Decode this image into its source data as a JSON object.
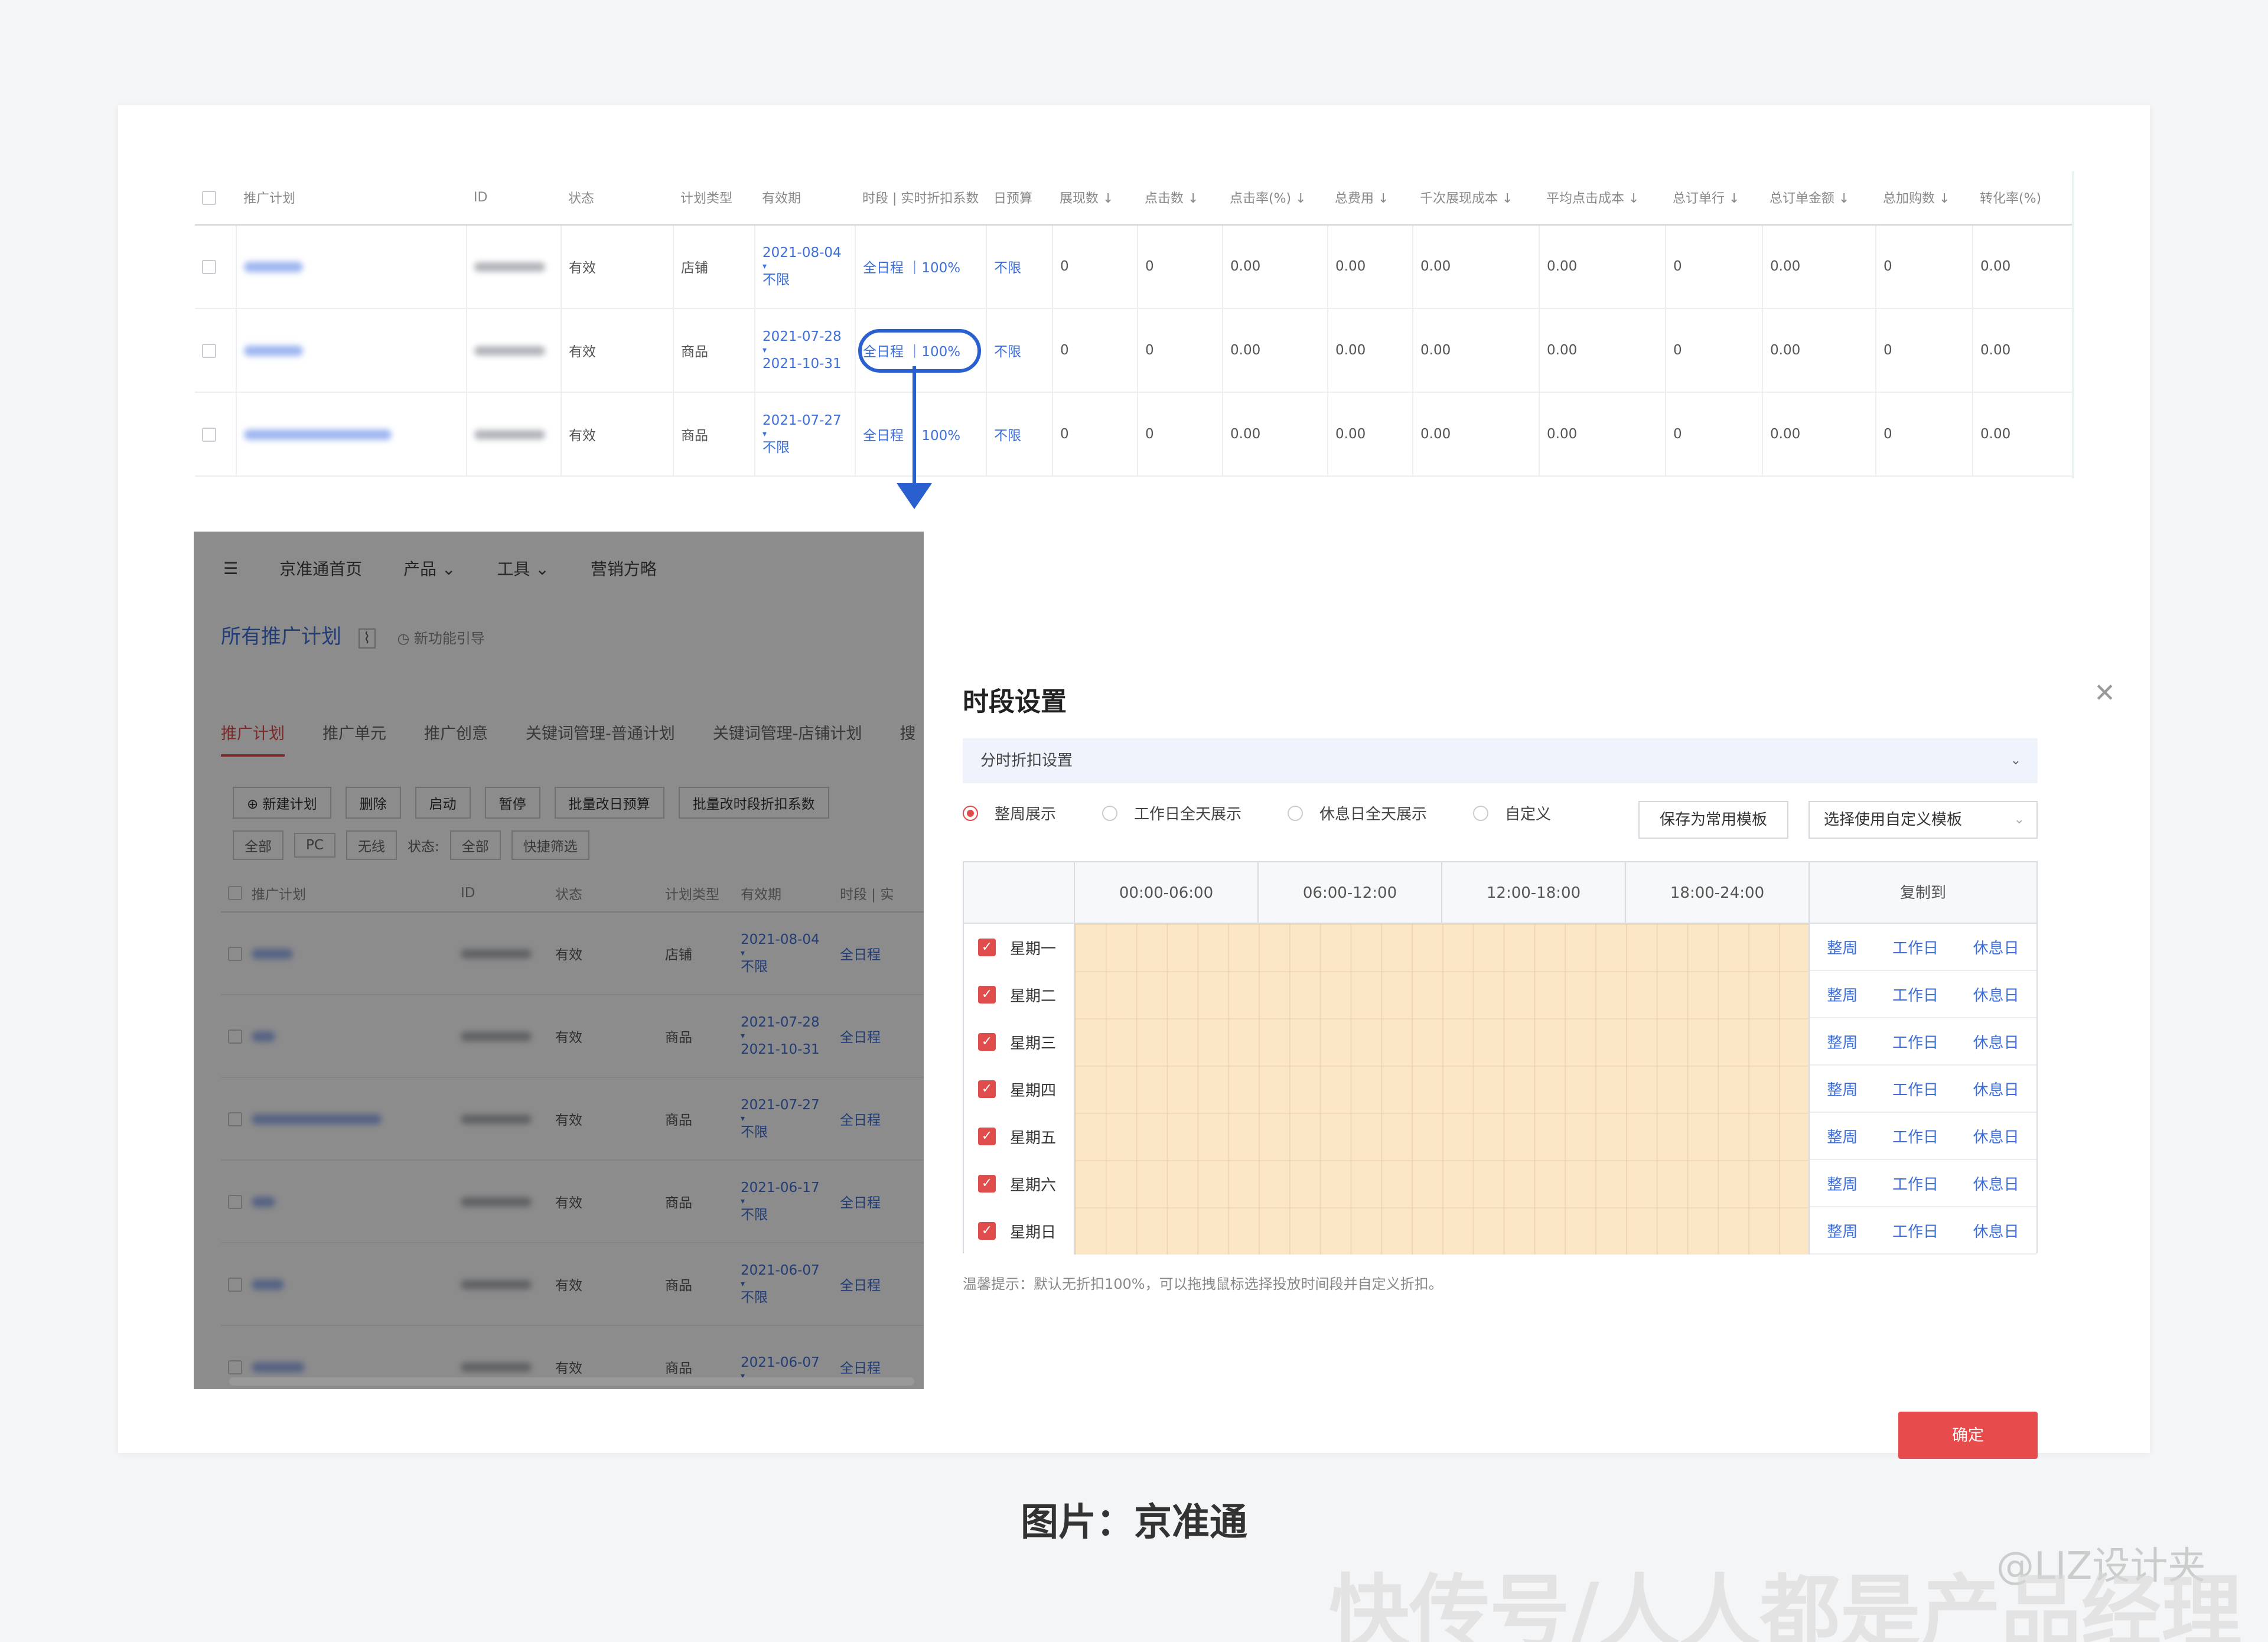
{
  "top_table": {
    "headers": [
      "推广计划",
      "ID",
      "状态",
      "计划类型",
      "有效期",
      "时段 | 实时折扣系数",
      "日预算",
      "展现数 ↓",
      "点击数 ↓",
      "点击率(%) ↓",
      "总费用 ↓",
      "千次展现成本 ↓",
      "平均点击成本 ↓",
      "总订单行 ↓",
      "总订单金额 ↓",
      "总加购数 ↓",
      "转化率(%)"
    ],
    "rows": [
      {
        "status": "有效",
        "type": "店铺",
        "date1": "2021-08-04",
        "date2": "不限",
        "period": "全日程 ｜100%",
        "budget": "不限",
        "impr": "0",
        "clicks": "0",
        "ctr": "0.00",
        "cost": "0.00",
        "cpm": "0.00",
        "cpc": "0.00",
        "orders": "0",
        "amount": "0.00",
        "cart": "0",
        "cvr": "0.00"
      },
      {
        "status": "有效",
        "type": "商品",
        "date1": "2021-07-28",
        "date2": "2021-10-31",
        "period": "全日程 ｜100%",
        "budget": "不限",
        "impr": "0",
        "clicks": "0",
        "ctr": "0.00",
        "cost": "0.00",
        "cpm": "0.00",
        "cpc": "0.00",
        "orders": "0",
        "amount": "0.00",
        "cart": "0",
        "cvr": "0.00"
      },
      {
        "status": "有效",
        "type": "商品",
        "date1": "2021-07-27",
        "date2": "不限",
        "period": "全日程 ｜100%",
        "budget": "不限",
        "impr": "0",
        "clicks": "0",
        "ctr": "0.00",
        "cost": "0.00",
        "cpm": "0.00",
        "cpc": "0.00",
        "orders": "0",
        "amount": "0.00",
        "cart": "0",
        "cvr": "0.00"
      }
    ]
  },
  "bg_app": {
    "menu_icon": "menu-icon",
    "nav": [
      "京准通首页",
      "产品 ⌄",
      "工具 ⌄",
      "营销方略"
    ],
    "title": "所有推广计划",
    "guide": "新功能引导",
    "tabs": [
      "推广计划",
      "推广单元",
      "推广创意",
      "关键词管理-普通计划",
      "关键词管理-店铺计划",
      "搜"
    ],
    "buttons": [
      "新建计划",
      "删除",
      "启动",
      "暂停",
      "批量改日预算",
      "批量改时段折扣系数"
    ],
    "filters": {
      "all": "全部",
      "pc": "PC",
      "wireless": "无线",
      "status_label": "状态:",
      "status_value": "全部",
      "quick": "快捷筛选"
    },
    "headers": [
      "推广计划",
      "ID",
      "状态",
      "计划类型",
      "有效期",
      "时段 | 实"
    ],
    "rows": [
      {
        "status": "有效",
        "type": "店铺",
        "date1": "2021-08-04",
        "date2": "不限",
        "period": "全日程"
      },
      {
        "status": "有效",
        "type": "商品",
        "date1": "2021-07-28",
        "date2": "2021-10-31",
        "period": "全日程"
      },
      {
        "status": "有效",
        "type": "商品",
        "date1": "2021-07-27",
        "date2": "不限",
        "period": "全日程"
      },
      {
        "status": "有效",
        "type": "商品",
        "date1": "2021-06-17",
        "date2": "不限",
        "period": "全日程"
      },
      {
        "status": "有效",
        "type": "商品",
        "date1": "2021-06-07",
        "date2": "不限",
        "period": "全日程"
      },
      {
        "status": "有效",
        "type": "商品",
        "date1": "2021-06-07",
        "date2": "",
        "period": "全日程"
      }
    ]
  },
  "modal": {
    "title": "时段设置",
    "close_icon": "close-icon",
    "section": "分时折扣设置",
    "radios": [
      "整周展示",
      "工作日全天展示",
      "休息日全天展示",
      "自定义"
    ],
    "save_template": "保存为常用模板",
    "select_template": "选择使用自定义模板",
    "time_headers": [
      "00:00-06:00",
      "06:00-12:00",
      "12:00-18:00",
      "18:00-24:00"
    ],
    "copy_header": "复制到",
    "days": [
      "星期一",
      "星期二",
      "星期三",
      "星期四",
      "星期五",
      "星期六",
      "星期日"
    ],
    "copy_actions": [
      "整周",
      "工作日",
      "休息日"
    ],
    "tip": "温馨提示：默认无折扣100%，可以拖拽鼠标选择投放时间段并自定义折扣。",
    "confirm": "确定"
  },
  "caption": "图片：京准通",
  "watermarks": {
    "author": "@LIZ设计夹",
    "site": "快传号/人人都是产品经理"
  },
  "colors": {
    "accent": "#e84b4b",
    "link": "#3e6fd8",
    "grid_fill": "#fbe7c6",
    "highlight": "#2a5fd0"
  }
}
